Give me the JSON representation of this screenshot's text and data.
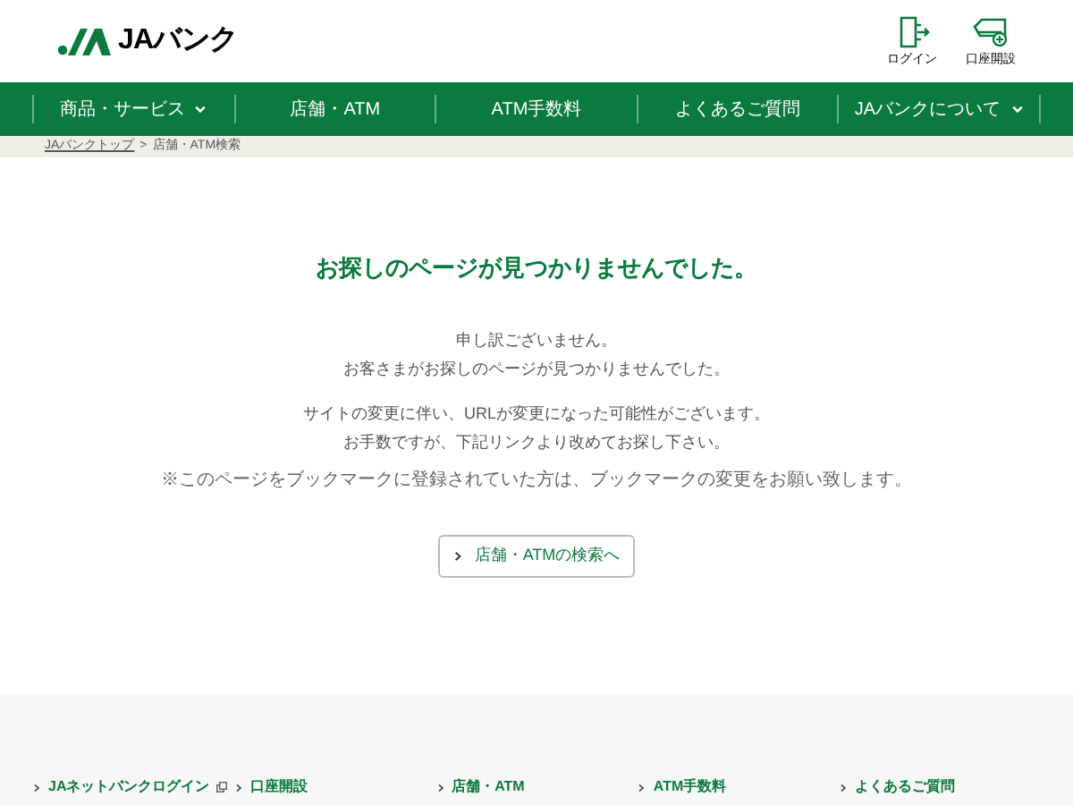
{
  "header": {
    "logo_text": "JAバンク",
    "actions": [
      {
        "kind": "login",
        "label": "ログイン"
      },
      {
        "kind": "account",
        "label": "口座開設"
      }
    ]
  },
  "nav": [
    {
      "label": "商品・サービス",
      "dropdown": true
    },
    {
      "label": "店舗・ATM",
      "dropdown": false
    },
    {
      "label": "ATM手数料",
      "dropdown": false
    },
    {
      "label": "よくあるご質問",
      "dropdown": false
    },
    {
      "label": "JAバンクについて",
      "dropdown": true
    }
  ],
  "breadcrumb": {
    "home": "JAバンクトップ",
    "separator": ">",
    "current": "店舗・ATM検索"
  },
  "main": {
    "heading": "お探しのページが見つかりませんでした。",
    "paragraphs": [
      [
        "申し訳ございません。",
        "お客さまがお探しのページが見つかりませんでした。"
      ],
      [
        "サイトの変更に伴い、URLが変更になった可能性がございます。",
        "お手数ですが、下記リンクより改めてお探し下さい。"
      ]
    ],
    "note": "※このページをブックマークに登録されていた方は、ブックマークの変更をお願い致します。",
    "button": "店舗・ATMの検索へ"
  },
  "footer_links": [
    {
      "label": "JAネットバンクログイン",
      "external": true
    },
    {
      "label": "口座開設",
      "external": false
    },
    {
      "label": "店舗・ATM",
      "external": false
    },
    {
      "label": "ATM手数料",
      "external": false
    },
    {
      "label": "よくあるご質問",
      "external": false
    }
  ]
}
